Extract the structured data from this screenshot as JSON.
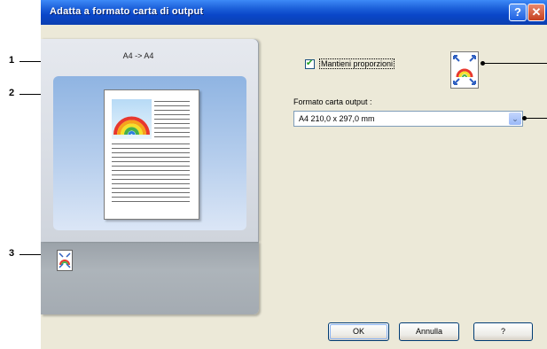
{
  "window": {
    "title": "Adatta a formato carta di output",
    "help_button": "?",
    "close_button": "✕"
  },
  "preview_panel": {
    "ratio_text": "A4 -> A4"
  },
  "options": {
    "keep_proportions_label": "Mantieni proporzioni",
    "keep_proportions_checked": true,
    "checkmark": "✔",
    "output_paper_label": "Formato carta output :",
    "output_paper_value": "A4   210,0 x 297,0 mm",
    "dropdown_arrow": "⌄"
  },
  "buttons": {
    "ok": "OK",
    "cancel": "Annulla",
    "help": "?"
  },
  "callouts": {
    "one": "1",
    "two": "2",
    "three": "3"
  },
  "colors": {
    "title_bar": "#0a47c9",
    "window_bg": "#ece9d8",
    "preview_bg": "#b3ccec"
  },
  "icons": {
    "fit_to_page": "fit-to-page-icon",
    "rainbow": "rainbow-picture-icon"
  }
}
